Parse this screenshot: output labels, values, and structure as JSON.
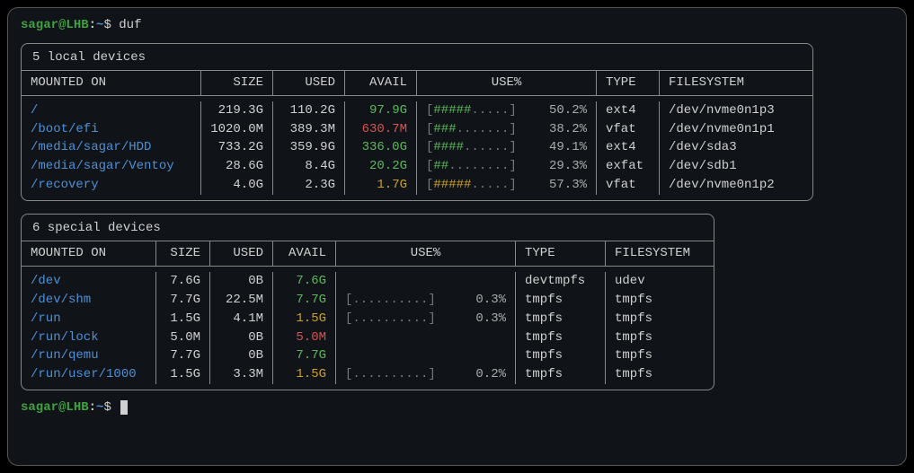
{
  "prompt": {
    "user": "sagar",
    "host": "LHB",
    "path": "~",
    "command": "duf"
  },
  "tables": [
    {
      "title": "5 local devices",
      "columns": [
        "MOUNTED ON",
        "SIZE",
        "USED",
        "AVAIL",
        "USE%",
        "TYPE",
        "FILESYSTEM"
      ],
      "widths": [
        200,
        80,
        80,
        80,
        200,
        70,
        170
      ],
      "rows": [
        {
          "mount": "/",
          "size": "219.3G",
          "used": "110.2G",
          "avail": "97.9G",
          "avail_color": "green",
          "bar": "[#####.....]",
          "fill": 5,
          "pct": "50.2%",
          "type": "ext4",
          "fs": "/dev/nvme0n1p3"
        },
        {
          "mount": "/boot/efi",
          "size": "1020.0M",
          "used": "389.3M",
          "avail": "630.7M",
          "avail_color": "red",
          "bar": "[###.......]",
          "fill": 3,
          "pct": "38.2%",
          "type": "vfat",
          "fs": "/dev/nvme0n1p1"
        },
        {
          "mount": "/media/sagar/HDD",
          "size": "733.2G",
          "used": "359.9G",
          "avail": "336.0G",
          "avail_color": "green",
          "bar": "[####......]",
          "fill": 4,
          "pct": "49.1%",
          "type": "ext4",
          "fs": "/dev/sda3"
        },
        {
          "mount": "/media/sagar/Ventoy",
          "size": "28.6G",
          "used": "8.4G",
          "avail": "20.2G",
          "avail_color": "green",
          "bar": "[##........]",
          "fill": 2,
          "pct": "29.3%",
          "type": "exfat",
          "fs": "/dev/sdb1"
        },
        {
          "mount": "/recovery",
          "size": "4.0G",
          "used": "2.3G",
          "avail": "1.7G",
          "avail_color": "yellow",
          "bar": "[#####.....]",
          "fill": 5,
          "pct": "57.3%",
          "type": "vfat",
          "fs": "/dev/nvme0n1p2"
        }
      ]
    },
    {
      "title": "6 special devices",
      "columns": [
        "MOUNTED ON",
        "SIZE",
        "USED",
        "AVAIL",
        "USE%",
        "TYPE",
        "FILESYSTEM"
      ],
      "widths": [
        150,
        60,
        70,
        70,
        200,
        100,
        120
      ],
      "rows": [
        {
          "mount": "/dev",
          "size": "7.6G",
          "used": "0B",
          "avail": "7.6G",
          "avail_color": "green",
          "bar": "",
          "fill": 0,
          "pct": "",
          "type": "devtmpfs",
          "fs": "udev"
        },
        {
          "mount": "/dev/shm",
          "size": "7.7G",
          "used": "22.5M",
          "avail": "7.7G",
          "avail_color": "green",
          "bar": "[..........]",
          "fill": 0,
          "pct": "0.3%",
          "type": "tmpfs",
          "fs": "tmpfs"
        },
        {
          "mount": "/run",
          "size": "1.5G",
          "used": "4.1M",
          "avail": "1.5G",
          "avail_color": "yellow",
          "bar": "[..........]",
          "fill": 0,
          "pct": "0.3%",
          "type": "tmpfs",
          "fs": "tmpfs"
        },
        {
          "mount": "/run/lock",
          "size": "5.0M",
          "used": "0B",
          "avail": "5.0M",
          "avail_color": "red",
          "bar": "",
          "fill": 0,
          "pct": "",
          "type": "tmpfs",
          "fs": "tmpfs"
        },
        {
          "mount": "/run/qemu",
          "size": "7.7G",
          "used": "0B",
          "avail": "7.7G",
          "avail_color": "green",
          "bar": "",
          "fill": 0,
          "pct": "",
          "type": "tmpfs",
          "fs": "tmpfs"
        },
        {
          "mount": "/run/user/1000",
          "size": "1.5G",
          "used": "3.3M",
          "avail": "1.5G",
          "avail_color": "yellow",
          "bar": "[..........]",
          "fill": 0,
          "pct": "0.2%",
          "type": "tmpfs",
          "fs": "tmpfs"
        }
      ]
    }
  ]
}
